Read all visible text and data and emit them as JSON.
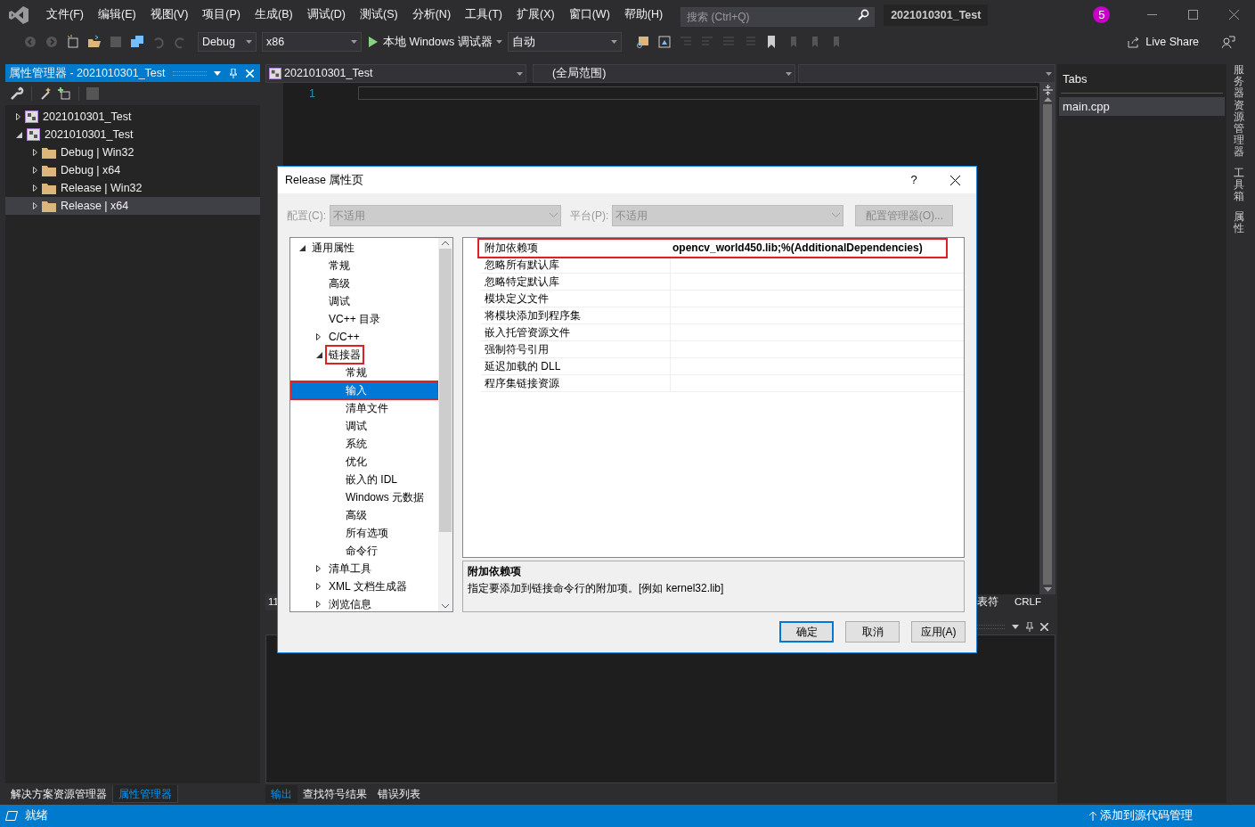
{
  "menu": [
    "文件(F)",
    "编辑(E)",
    "视图(V)",
    "项目(P)",
    "生成(B)",
    "调试(D)",
    "测试(S)",
    "分析(N)",
    "工具(T)",
    "扩展(X)",
    "窗口(W)",
    "帮助(H)"
  ],
  "search": {
    "placeholder": "搜索 (Ctrl+Q)"
  },
  "solution_name": "2021010301_Test",
  "notification_count": "5",
  "toolbar": {
    "configuration": "Debug",
    "platform": "x86",
    "run_label": "本地 Windows 调试器",
    "run_mode": "自动",
    "live_share": "Live Share"
  },
  "property_manager": {
    "title": "属性管理器 - 2021010301_Test",
    "tree": [
      {
        "label": "2021010301_Test",
        "kind": "project",
        "expanded": false,
        "selected": false
      },
      {
        "label": "2021010301_Test",
        "kind": "project",
        "expanded": true,
        "selected": false,
        "children": [
          {
            "label": "Debug | Win32",
            "kind": "folder",
            "expanded": false,
            "selected": false
          },
          {
            "label": "Debug | x64",
            "kind": "folder",
            "expanded": false,
            "selected": false
          },
          {
            "label": "Release | Win32",
            "kind": "folder",
            "expanded": false,
            "selected": false
          },
          {
            "label": "Release | x64",
            "kind": "folder",
            "expanded": false,
            "selected": true
          }
        ]
      }
    ]
  },
  "editor": {
    "project_dropdown": "2021010301_Test",
    "scope_dropdown": "(全局范围)",
    "line_numbers": [
      "1"
    ],
    "line": "11",
    "indent": "表符",
    "line_ending": "CRLF"
  },
  "tabs_panel": {
    "title": "Tabs",
    "items": [
      {
        "label": "main.cpp",
        "selected": true
      }
    ]
  },
  "side_tabs": [
    "服务器资源管理器",
    "工具箱",
    "属性"
  ],
  "left_bottom_tabs": [
    {
      "label": "解决方案资源管理器",
      "selected": false
    },
    {
      "label": "属性管理器",
      "selected": true
    }
  ],
  "output_bottom_tabs": [
    {
      "label": "输出",
      "selected": true
    },
    {
      "label": "查找符号结果",
      "selected": false
    },
    {
      "label": "错误列表",
      "selected": false
    }
  ],
  "status_bar": {
    "text": "就绪",
    "source_control": "添加到源代码管理"
  },
  "dialog": {
    "title": "Release 属性页",
    "help": "?",
    "configuration_label": "配置(C):",
    "configuration_value": "不适用",
    "platform_label": "平台(P):",
    "platform_value": "不适用",
    "config_manager": "配置管理器(O)...",
    "tree": [
      {
        "label": "通用属性",
        "expanded": true,
        "selected": false,
        "children": [
          {
            "label": "常规",
            "selected": false
          },
          {
            "label": "高级",
            "selected": false
          },
          {
            "label": "调试",
            "selected": false
          },
          {
            "label": "VC++ 目录",
            "selected": false
          },
          {
            "label": "C/C++",
            "expanded": false,
            "selected": false
          },
          {
            "label": "链接器",
            "expanded": true,
            "selected": false,
            "marked": true,
            "children": [
              {
                "label": "常规",
                "selected": false
              },
              {
                "label": "输入",
                "selected": true,
                "marked": true
              },
              {
                "label": "清单文件",
                "selected": false
              },
              {
                "label": "调试",
                "selected": false
              },
              {
                "label": "系统",
                "selected": false
              },
              {
                "label": "优化",
                "selected": false
              },
              {
                "label": "嵌入的 IDL",
                "selected": false
              },
              {
                "label": "Windows 元数据",
                "selected": false
              },
              {
                "label": "高级",
                "selected": false
              },
              {
                "label": "所有选项",
                "selected": false
              },
              {
                "label": "命令行",
                "selected": false
              }
            ]
          },
          {
            "label": "清单工具",
            "expanded": false,
            "selected": false
          },
          {
            "label": "XML 文档生成器",
            "expanded": false,
            "selected": false
          },
          {
            "label": "浏览信息",
            "expanded": false,
            "selected": false
          }
        ]
      }
    ],
    "properties": [
      {
        "name": "附加依赖项",
        "value": "opencv_world450.lib;%(AdditionalDependencies)",
        "marked": true
      },
      {
        "name": "忽略所有默认库"
      },
      {
        "name": "忽略特定默认库"
      },
      {
        "name": "模块定义文件"
      },
      {
        "name": "将模块添加到程序集"
      },
      {
        "name": "嵌入托管资源文件"
      },
      {
        "name": "强制符号引用"
      },
      {
        "name": "延迟加载的 DLL"
      },
      {
        "name": "程序集链接资源"
      }
    ],
    "description_title": "附加依赖项",
    "description": "指定要添加到链接命令行的附加项。[例如 kernel32.lib]",
    "buttons": [
      {
        "label": "确定",
        "default": true
      },
      {
        "label": "取消",
        "default": false
      },
      {
        "label": "应用(A)",
        "default": false
      }
    ]
  }
}
